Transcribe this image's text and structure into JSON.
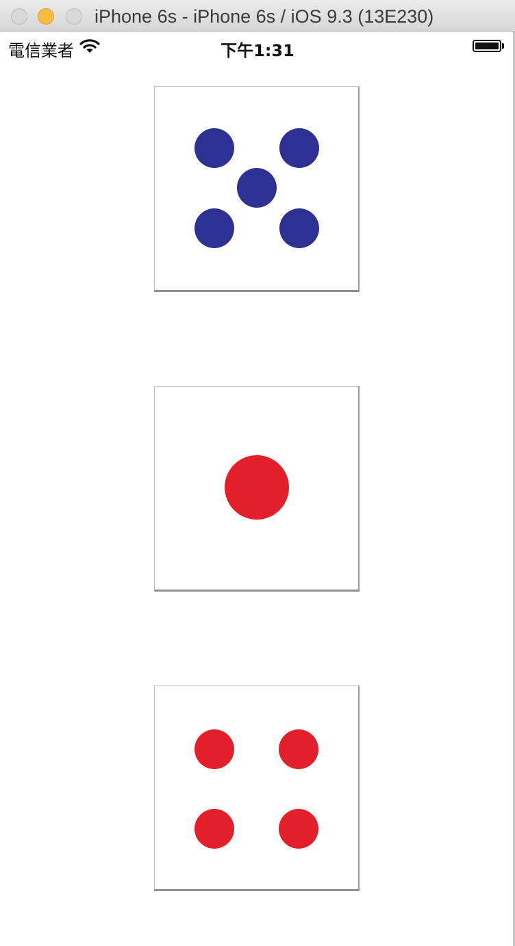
{
  "window": {
    "title": "iPhone 6s - iPhone 6s / iOS 9.3 (13E230)"
  },
  "status_bar": {
    "carrier": "電信業者",
    "time": "下午1:31",
    "battery_level": 1.0
  },
  "dice": [
    {
      "value": 5,
      "pip_color": "#2e3192"
    },
    {
      "value": 1,
      "pip_color": "#e3202a"
    },
    {
      "value": 4,
      "pip_color": "#e3202a"
    }
  ],
  "colors": {
    "close_button": "#d9d9d9",
    "minimize_button": "#fdbc40",
    "zoom_button": "#d9d9d9",
    "blue_pip": "#2e3192",
    "red_pip": "#e3202a"
  },
  "icons": [
    "close-icon",
    "minimize-icon",
    "zoom-icon",
    "wifi-icon",
    "battery-icon"
  ]
}
